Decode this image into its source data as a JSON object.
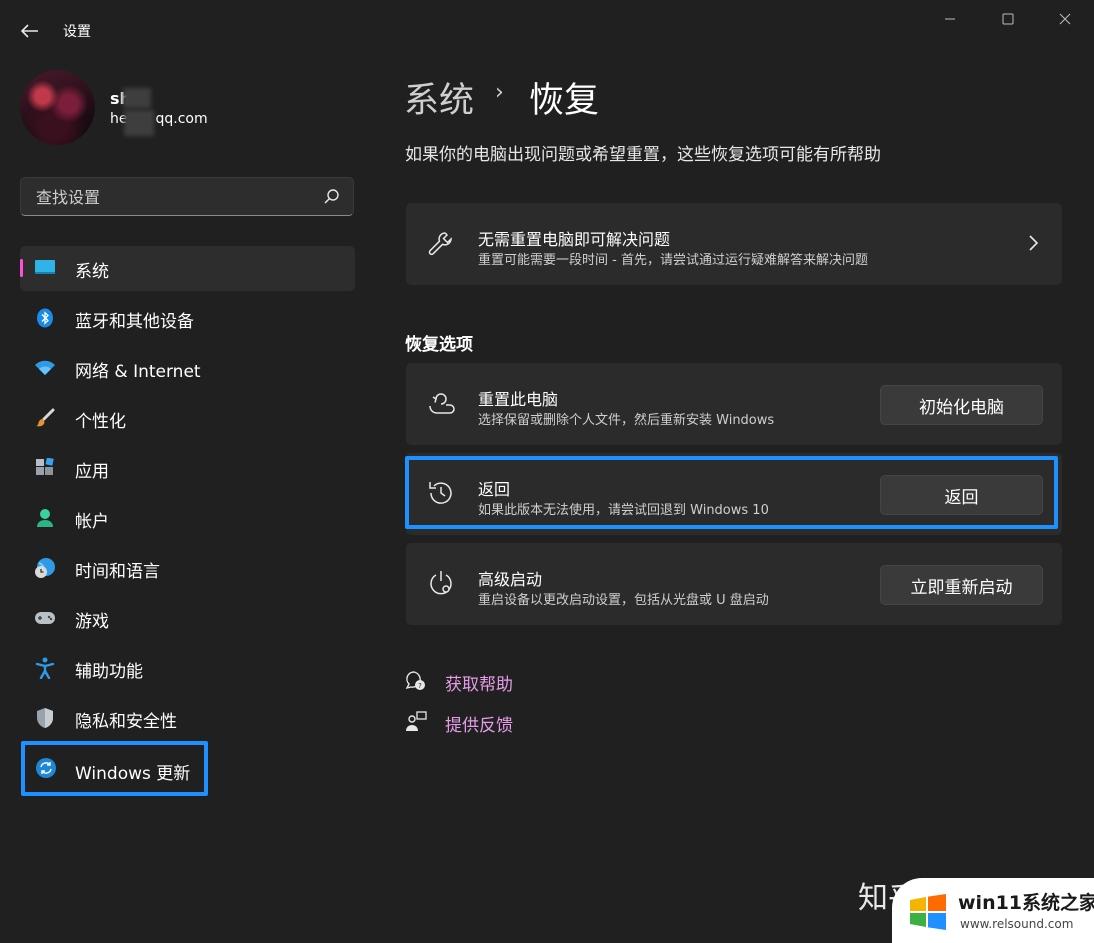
{
  "window": {
    "title": "设置",
    "controls": [
      "minimize",
      "maximize",
      "close"
    ]
  },
  "profile": {
    "name": "sh",
    "email_prefix": "he",
    "email_domain": "qq.com"
  },
  "search": {
    "placeholder": "查找设置"
  },
  "sidebar": {
    "items": [
      {
        "label": "系统",
        "icon": "monitor-icon",
        "active": true
      },
      {
        "label": "蓝牙和其他设备",
        "icon": "bluetooth-icon"
      },
      {
        "label": "网络 & Internet",
        "icon": "wifi-icon"
      },
      {
        "label": "个性化",
        "icon": "brush-icon"
      },
      {
        "label": "应用",
        "icon": "apps-icon"
      },
      {
        "label": "帐户",
        "icon": "account-icon"
      },
      {
        "label": "时间和语言",
        "icon": "globe-clock-icon"
      },
      {
        "label": "游戏",
        "icon": "gamepad-icon"
      },
      {
        "label": "辅助功能",
        "icon": "accessibility-icon"
      },
      {
        "label": "隐私和安全性",
        "icon": "shield-icon"
      },
      {
        "label": "Windows 更新",
        "icon": "sync-icon"
      }
    ]
  },
  "main": {
    "breadcrumb_parent": "系统",
    "breadcrumb_separator": "›",
    "breadcrumb_current": "恢复",
    "description": "如果你的电脑出现问题或希望重置，这些恢复选项可能有所帮助",
    "fix_card": {
      "title": "无需重置电脑即可解决问题",
      "subtitle": "重置可能需要一段时间 - 首先，请尝试通过运行疑难解答来解决问题"
    },
    "section_title": "恢复选项",
    "options": [
      {
        "title": "重置此电脑",
        "subtitle": "选择保留或删除个人文件，然后重新安装 Windows",
        "button": "初始化电脑",
        "icon": "reset-pc-icon"
      },
      {
        "title": "返回",
        "subtitle": "如果此版本无法使用，请尝试回退到 Windows 10",
        "button": "返回",
        "icon": "history-icon"
      },
      {
        "title": "高级启动",
        "subtitle": "重启设备以更改启动设置，包括从光盘或 U 盘启动",
        "button": "立即重新启动",
        "icon": "advanced-startup-icon"
      }
    ],
    "links": [
      {
        "label": "获取帮助",
        "icon": "help-icon"
      },
      {
        "label": "提供反馈",
        "icon": "feedback-icon"
      }
    ]
  },
  "watermark": {
    "zhihu": "知乎 @牛逼鹏",
    "site_name": "win11系统之家",
    "site_url": "www.relsound.com"
  },
  "colors": {
    "background": "#202020",
    "card": "#2b2b2b",
    "accent_pink": "#ff4fd8",
    "highlight_blue": "#1e90ff",
    "link": "#e59ce8"
  }
}
